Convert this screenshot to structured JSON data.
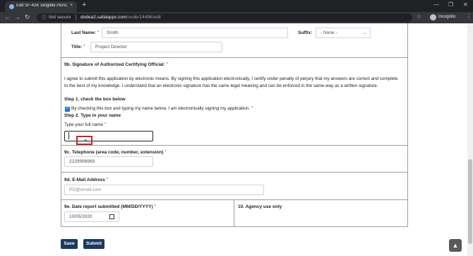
{
  "browser": {
    "tab_title": "Edit SF-428 Tangible Personal Pr...",
    "tab_close": "×",
    "new_tab": "+",
    "security_label": "Not secure",
    "url_host": "dodea2.safalapps.com",
    "url_path": "/node/14496/edit",
    "profile_label": "Incognito",
    "icons": [
      "back-icon",
      "forward-icon",
      "reload-icon",
      "home-icon",
      "lock-icon",
      "star-icon",
      "incognito-icon",
      "menu-icon"
    ]
  },
  "form": {
    "last_name": {
      "label": "Last Name:",
      "required": "*",
      "value": "Smith"
    },
    "suffix": {
      "label": "Suffix:",
      "selected": "- None -"
    },
    "title": {
      "label": "Title:",
      "required": "*",
      "value": "Project Director"
    },
    "signature": {
      "heading": "9b. Signature of Authorized Certifying Official:",
      "required": "*",
      "agreement_text": "I agree to submit this application by electronic means. By signing this application electronically, I certify under penalty of perjury that my answers are correct and complete to the best of my knowledge. I understand that an electronic signature has the same legal meaning and can be enforced in the same way as a written signature.",
      "step1": "Step 1. check the box below",
      "checkbox_label": "By checking this box and typing my name below, I am electronically signing my application.",
      "checkbox_required": "*",
      "checked": true,
      "step2": "Step 2. Type in your name",
      "fullname_label": "Type your full name",
      "fullname_required": "*",
      "fullname_value": ""
    },
    "telephone": {
      "label": "9c. Telephone (area code, number, extension)",
      "required": "*",
      "value": "2229998989"
    },
    "email": {
      "label": "9d. E-Mail Address",
      "required": "*",
      "placeholder": "PD@email.com"
    },
    "date": {
      "label": "9e. Date report submitted (MM/DD/YYYY)",
      "required": "*",
      "value": "10/05/2020"
    },
    "agency": {
      "label": "10. Agency use only"
    }
  },
  "actions": {
    "save_label": "Save",
    "submit_label": "Submit",
    "back_to_top": "▲"
  },
  "colors": {
    "button_bg": "#1c3a5f",
    "required": "#cc0000",
    "highlight": "#c62828",
    "chrome_dark": "#202124"
  }
}
